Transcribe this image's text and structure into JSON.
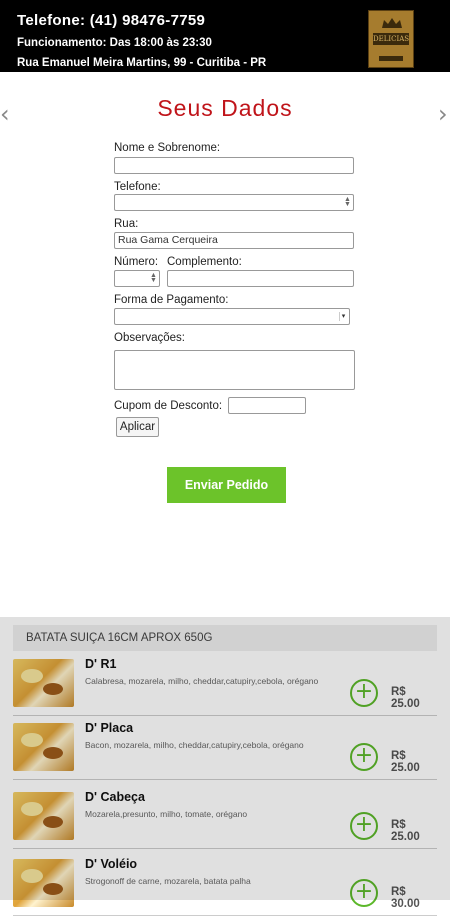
{
  "header": {
    "phone": "Telefone: (41) 98476-7759",
    "hours": "Funcionamento: Das 18:00 às 23:30",
    "address": "Rua Emanuel Meira Martins, 99 - Curitiba - PR",
    "logo_icon": "restaurant-logo",
    "logo_text": "DELICIAS"
  },
  "form": {
    "title": "Seus Dados",
    "prev_arrow": "‹",
    "next_arrow": "›",
    "name_label": "Nome e Sobrenome:",
    "name_value": "",
    "phone_label": "Telefone:",
    "phone_value": "",
    "street_label": "Rua:",
    "street_value": "Rua Gama Cerqueira",
    "number_label": "Número:",
    "number_value": "",
    "complement_label": "Complemento:",
    "complement_value": "",
    "payment_label": "Forma de Pagamento:",
    "payment_value": "",
    "notes_label": "Observações:",
    "notes_value": "",
    "coupon_label": "Cupom de Desconto:",
    "coupon_value": "",
    "apply_label": "Aplicar",
    "send_label": "Enviar Pedido"
  },
  "menu": {
    "category": "BATATA SUIÇA 16CM APROX 650G",
    "add_icon": "plus-circle-icon",
    "items": [
      {
        "name": "D' R1",
        "desc": "Calabresa, mozarela, milho, cheddar,catupiry,cebola, orégano",
        "price": "R$ 25.00"
      },
      {
        "name": "D' Placa",
        "desc": "Bacon, mozarela, milho, cheddar,catupiry,cebola, orégano",
        "price": "R$ 25.00"
      },
      {
        "name": "D' Cabeça",
        "desc": "Mozarela,presunto, milho, tomate, orégano",
        "price": "R$ 25.00"
      },
      {
        "name": "D' Voléio",
        "desc": "Strogonoff de carne, mozarela, batata palha",
        "price": "R$ 30.00"
      }
    ]
  },
  "colors": {
    "title": "#c0141a",
    "send_button": "#6cc32a",
    "add_icon": "#5cb82a",
    "header_bg": "#000000"
  }
}
